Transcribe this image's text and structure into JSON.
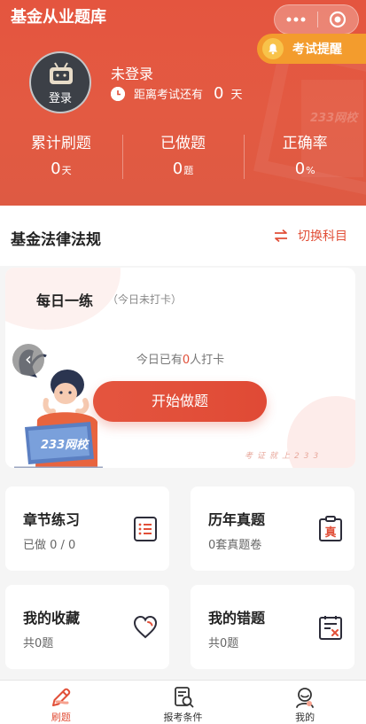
{
  "header": {
    "app_title": "基金从业题库",
    "capsule": {
      "more_icon": "dots-icon",
      "close_icon": "target-icon"
    },
    "reminder": {
      "label": "考试提醒",
      "icon": "bell-icon"
    },
    "avatar_label": "登录",
    "user_name": "未登录",
    "countdown": {
      "label": "距离考试还有",
      "value": "0",
      "unit": "天"
    },
    "watermark": "233网校",
    "stats": [
      {
        "label": "累计刷题",
        "value": "0",
        "unit": "天"
      },
      {
        "label": "已做题",
        "value": "0",
        "unit": "题"
      },
      {
        "label": "正确率",
        "value": "0",
        "unit": "%"
      }
    ]
  },
  "subject": {
    "title": "基金法律法规",
    "switch_label": "切换科目"
  },
  "daily": {
    "title": "每日一练",
    "status": "（今日未打卡）",
    "checkin_prefix": "今日已有",
    "checkin_count": "0",
    "checkin_suffix": "人打卡",
    "start_label": "开始做题",
    "slogan": "考证就上233",
    "laptop_text": "233网校"
  },
  "features": [
    {
      "title": "章节练习",
      "subtitle": "已做 0 / 0",
      "icon": "list-icon"
    },
    {
      "title": "历年真题",
      "subtitle": "0套真题卷",
      "icon": "clipboard-icon",
      "icon_text": "真"
    },
    {
      "title": "我的收藏",
      "subtitle": "共0题",
      "icon": "heart-icon"
    },
    {
      "title": "我的错题",
      "subtitle": "共0题",
      "icon": "wrong-note-icon"
    }
  ],
  "tabbar": [
    {
      "label": "刷题",
      "icon": "pencil-icon",
      "active": true
    },
    {
      "label": "报考条件",
      "icon": "document-search-icon",
      "active": false
    },
    {
      "label": "我的",
      "icon": "person-icon",
      "active": false
    }
  ],
  "colors": {
    "primary": "#e14f38",
    "reminder": "#f39c2d",
    "background": "#f5f5f5"
  }
}
